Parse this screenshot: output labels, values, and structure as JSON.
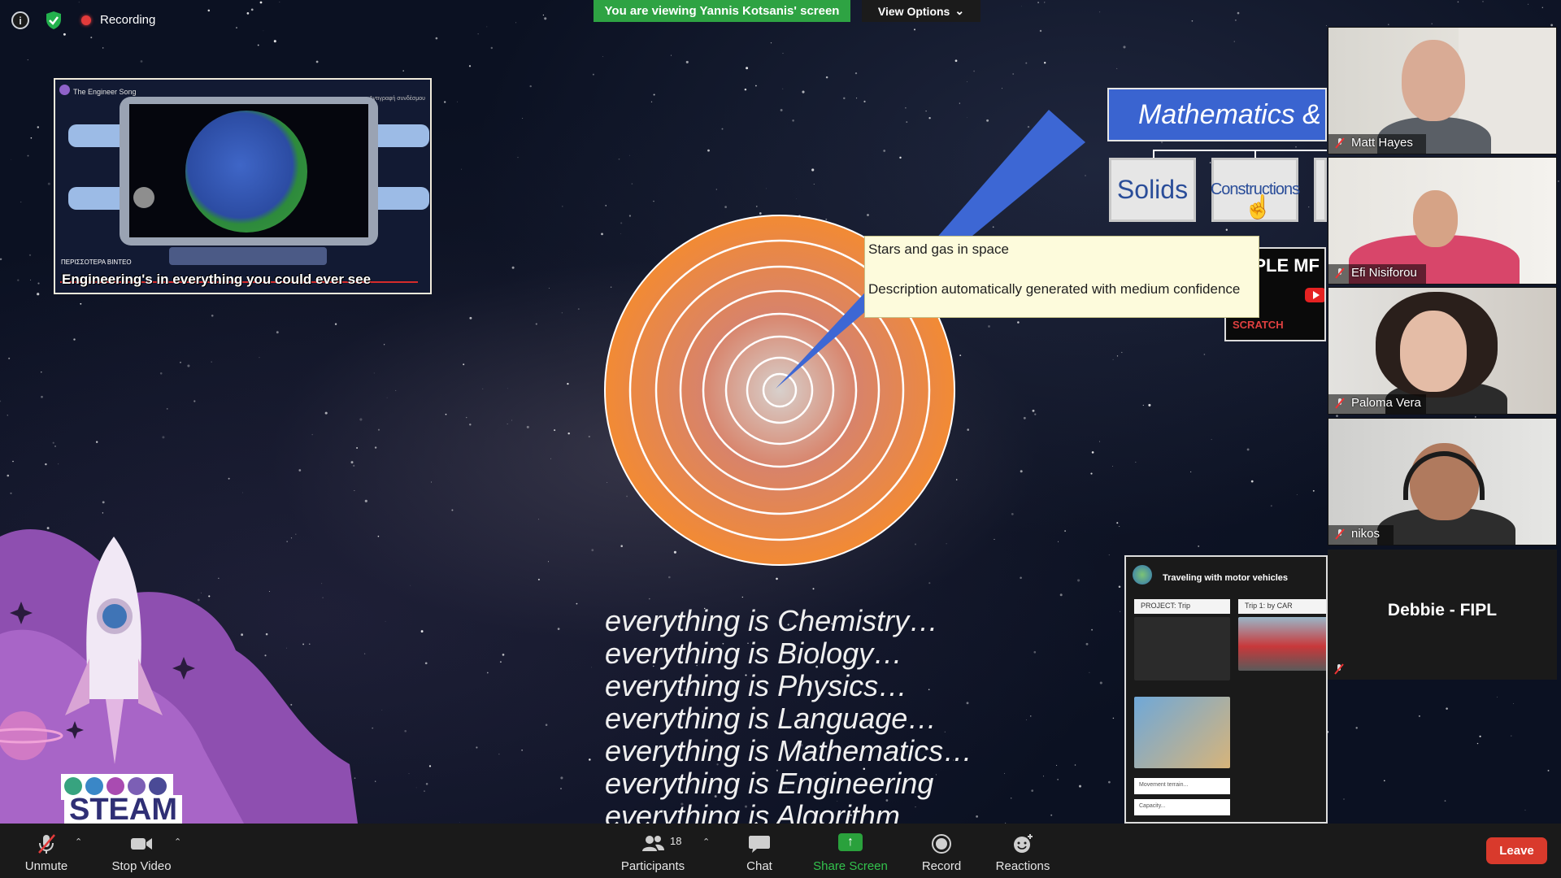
{
  "header": {
    "recording_label": "Recording",
    "viewing_banner": "You are viewing Yannis Kotsanis' screen",
    "view_options_label": "View Options"
  },
  "shared_screen": {
    "video": {
      "title": "The Engineer Song",
      "subtitle_right": "Αντιγραφή συνδέσμου",
      "more_videos_label": "ΠΕΡΙΣΣΟΤΕΡΑ ΒΙΝΤΕΟ",
      "caption": "Engineering's in everything you could ever see"
    },
    "mindmap": {
      "header": "Mathematics &",
      "boxes": [
        "Solids",
        "Constructions"
      ]
    },
    "small_thumbnail": {
      "text": "APPLE MF",
      "brand": "SCRATCH"
    },
    "tooltip": {
      "line1": "Stars and gas in space",
      "line2": "Description automatically generated with medium confidence"
    },
    "lines": [
      "everything is Chemistry…",
      "everything is Biology…",
      "everything is Physics…",
      "everything is Language…",
      "everything is Mathematics…",
      "everything is Engineering",
      "everything is Algorithm"
    ],
    "steam_logo": "STEAM",
    "app_card": {
      "title": "Traveling with motor vehicles",
      "chip_project": "PROJECT: Trip",
      "chip_trip": "Trip 1: by CAR",
      "field1": "Movement terrain...",
      "field2": "Capacity..."
    }
  },
  "participants": [
    {
      "name": "Matt Hayes"
    },
    {
      "name": "Efi Nisiforou"
    },
    {
      "name": "Paloma Vera"
    },
    {
      "name": "nikos"
    }
  ],
  "debbie_tile": {
    "name": "Debbie - FIPL"
  },
  "toolbar": {
    "unmute": "Unmute",
    "stop_video": "Stop Video",
    "participants": "Participants",
    "participants_count": "18",
    "chat": "Chat",
    "share_screen": "Share Screen",
    "record": "Record",
    "reactions": "Reactions",
    "leave": "Leave"
  },
  "colors": {
    "banner_green": "#2ea343",
    "leave_red": "#d93a2c",
    "target_orange": "#f08a3a",
    "mindmap_blue": "#3a64d0"
  }
}
